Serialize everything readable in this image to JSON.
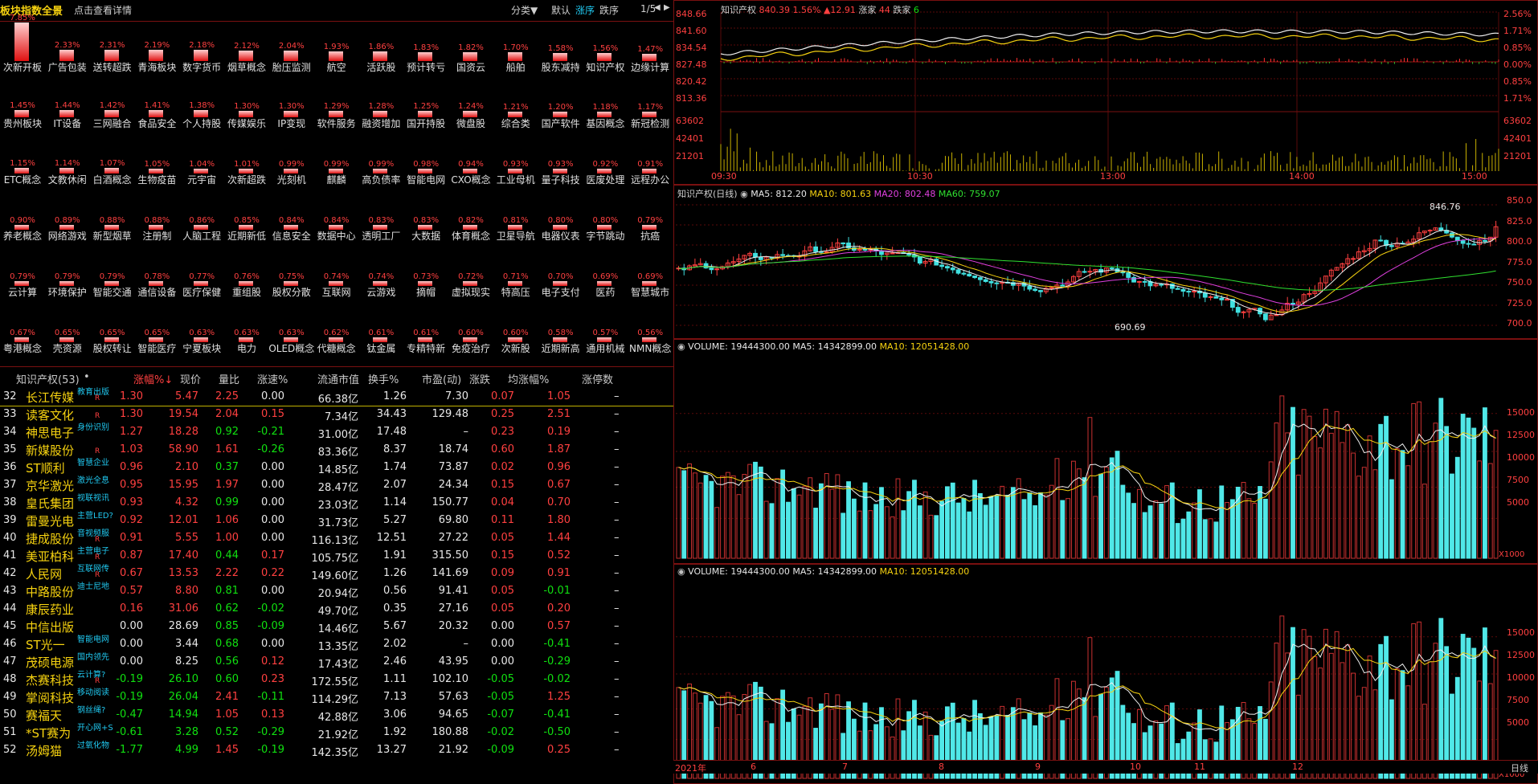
{
  "header": {
    "title": "板块指数全景",
    "detail_link": "点击查看详情",
    "sort_menu": "分类▼",
    "sort_default": "默认",
    "sort_up": "涨序",
    "sort_down": "跌序",
    "page": "1/5",
    "nav_left": "◀",
    "nav_right": "▶"
  },
  "sectors": [
    {
      "name": "次新开板",
      "pct": "7.85%",
      "v": 7.85
    },
    {
      "name": "广告包装",
      "pct": "2.33%",
      "v": 2.33
    },
    {
      "name": "送转超跌",
      "pct": "2.31%",
      "v": 2.31
    },
    {
      "name": "青海板块",
      "pct": "2.19%",
      "v": 2.19
    },
    {
      "name": "数字货币",
      "pct": "2.18%",
      "v": 2.18
    },
    {
      "name": "烟草概念",
      "pct": "2.12%",
      "v": 2.12
    },
    {
      "name": "胎压监测",
      "pct": "2.04%",
      "v": 2.04
    },
    {
      "name": "航空",
      "pct": "1.93%",
      "v": 1.93
    },
    {
      "name": "活跃股",
      "pct": "1.86%",
      "v": 1.86
    },
    {
      "name": "预计转亏",
      "pct": "1.83%",
      "v": 1.83
    },
    {
      "name": "国资云",
      "pct": "1.82%",
      "v": 1.82
    },
    {
      "name": "船舶",
      "pct": "1.70%",
      "v": 1.7
    },
    {
      "name": "股东减持",
      "pct": "1.58%",
      "v": 1.58
    },
    {
      "name": "知识产权",
      "pct": "1.56%",
      "v": 1.56
    },
    {
      "name": "边缘计算",
      "pct": "1.47%",
      "v": 1.47
    },
    {
      "name": "贵州板块",
      "pct": "1.45%",
      "v": 1.45
    },
    {
      "name": "IT设备",
      "pct": "1.44%",
      "v": 1.44
    },
    {
      "name": "三网融合",
      "pct": "1.42%",
      "v": 1.42
    },
    {
      "name": "食品安全",
      "pct": "1.41%",
      "v": 1.41
    },
    {
      "name": "个人持股",
      "pct": "1.38%",
      "v": 1.38
    },
    {
      "name": "传媒娱乐",
      "pct": "1.30%",
      "v": 1.3
    },
    {
      "name": "IP变现",
      "pct": "1.30%",
      "v": 1.3
    },
    {
      "name": "软件服务",
      "pct": "1.29%",
      "v": 1.29
    },
    {
      "name": "融资增加",
      "pct": "1.28%",
      "v": 1.28
    },
    {
      "name": "国开持股",
      "pct": "1.25%",
      "v": 1.25
    },
    {
      "name": "微盘股",
      "pct": "1.24%",
      "v": 1.24
    },
    {
      "name": "综合类",
      "pct": "1.21%",
      "v": 1.21
    },
    {
      "name": "国产软件",
      "pct": "1.20%",
      "v": 1.2
    },
    {
      "name": "基因概念",
      "pct": "1.18%",
      "v": 1.18
    },
    {
      "name": "新冠检测",
      "pct": "1.17%",
      "v": 1.17
    },
    {
      "name": "ETC概念",
      "pct": "1.15%",
      "v": 1.15
    },
    {
      "name": "文教休闲",
      "pct": "1.14%",
      "v": 1.14
    },
    {
      "name": "白酒概念",
      "pct": "1.07%",
      "v": 1.07
    },
    {
      "name": "生物疫苗",
      "pct": "1.05%",
      "v": 1.05
    },
    {
      "name": "元宇宙",
      "pct": "1.04%",
      "v": 1.04
    },
    {
      "name": "次新超跌",
      "pct": "1.01%",
      "v": 1.01
    },
    {
      "name": "光刻机",
      "pct": "0.99%",
      "v": 0.99
    },
    {
      "name": "麒麟",
      "pct": "0.99%",
      "v": 0.99
    },
    {
      "name": "高负债率",
      "pct": "0.99%",
      "v": 0.99
    },
    {
      "name": "智能电网",
      "pct": "0.98%",
      "v": 0.98
    },
    {
      "name": "CXO概念",
      "pct": "0.94%",
      "v": 0.94
    },
    {
      "name": "工业母机",
      "pct": "0.93%",
      "v": 0.93
    },
    {
      "name": "量子科技",
      "pct": "0.93%",
      "v": 0.93
    },
    {
      "name": "医废处理",
      "pct": "0.92%",
      "v": 0.92
    },
    {
      "name": "远程办公",
      "pct": "0.91%",
      "v": 0.91
    },
    {
      "name": "养老概念",
      "pct": "0.90%",
      "v": 0.9
    },
    {
      "name": "网络游戏",
      "pct": "0.89%",
      "v": 0.89
    },
    {
      "name": "新型烟草",
      "pct": "0.88%",
      "v": 0.88
    },
    {
      "name": "注册制",
      "pct": "0.88%",
      "v": 0.88
    },
    {
      "name": "人脑工程",
      "pct": "0.86%",
      "v": 0.86
    },
    {
      "name": "近期新低",
      "pct": "0.85%",
      "v": 0.85
    },
    {
      "name": "信息安全",
      "pct": "0.84%",
      "v": 0.84
    },
    {
      "name": "数据中心",
      "pct": "0.84%",
      "v": 0.84
    },
    {
      "name": "透明工厂",
      "pct": "0.83%",
      "v": 0.83
    },
    {
      "name": "大数据",
      "pct": "0.83%",
      "v": 0.83
    },
    {
      "name": "体育概念",
      "pct": "0.82%",
      "v": 0.82
    },
    {
      "name": "卫星导航",
      "pct": "0.81%",
      "v": 0.81
    },
    {
      "name": "电器仪表",
      "pct": "0.80%",
      "v": 0.8
    },
    {
      "name": "字节跳动",
      "pct": "0.80%",
      "v": 0.8
    },
    {
      "name": "抗癌",
      "pct": "0.79%",
      "v": 0.79
    },
    {
      "name": "云计算",
      "pct": "0.79%",
      "v": 0.79
    },
    {
      "name": "环境保护",
      "pct": "0.79%",
      "v": 0.79
    },
    {
      "name": "智能交通",
      "pct": "0.79%",
      "v": 0.79
    },
    {
      "name": "通信设备",
      "pct": "0.78%",
      "v": 0.78
    },
    {
      "name": "医疗保健",
      "pct": "0.77%",
      "v": 0.77
    },
    {
      "name": "重组股",
      "pct": "0.76%",
      "v": 0.76
    },
    {
      "name": "股权分散",
      "pct": "0.75%",
      "v": 0.75
    },
    {
      "name": "互联网",
      "pct": "0.74%",
      "v": 0.74
    },
    {
      "name": "云游戏",
      "pct": "0.74%",
      "v": 0.74
    },
    {
      "name": "摘帽",
      "pct": "0.73%",
      "v": 0.73
    },
    {
      "name": "虚拟现实",
      "pct": "0.72%",
      "v": 0.72
    },
    {
      "name": "特高压",
      "pct": "0.71%",
      "v": 0.71
    },
    {
      "name": "电子支付",
      "pct": "0.70%",
      "v": 0.7
    },
    {
      "name": "医药",
      "pct": "0.69%",
      "v": 0.69
    },
    {
      "name": "智慧城市",
      "pct": "0.69%",
      "v": 0.69
    },
    {
      "name": "粤港概念",
      "pct": "0.67%",
      "v": 0.67
    },
    {
      "name": "壳资源",
      "pct": "0.65%",
      "v": 0.65
    },
    {
      "name": "股权转让",
      "pct": "0.65%",
      "v": 0.65
    },
    {
      "name": "智能医疗",
      "pct": "0.65%",
      "v": 0.65
    },
    {
      "name": "宁夏板块",
      "pct": "0.63%",
      "v": 0.63
    },
    {
      "name": "电力",
      "pct": "0.63%",
      "v": 0.63
    },
    {
      "name": "OLED概念",
      "pct": "0.63%",
      "v": 0.63
    },
    {
      "name": "代糖概念",
      "pct": "0.62%",
      "v": 0.62
    },
    {
      "name": "钛金属",
      "pct": "0.61%",
      "v": 0.61
    },
    {
      "name": "专精特新",
      "pct": "0.61%",
      "v": 0.61
    },
    {
      "name": "免疫治疗",
      "pct": "0.60%",
      "v": 0.6
    },
    {
      "name": "次新股",
      "pct": "0.60%",
      "v": 0.6
    },
    {
      "name": "近期新高",
      "pct": "0.58%",
      "v": 0.58
    },
    {
      "name": "通用机械",
      "pct": "0.57%",
      "v": 0.57
    },
    {
      "name": "NMN概念",
      "pct": "0.56%",
      "v": 0.56
    }
  ],
  "table": {
    "headers": [
      "知识产权(53)",
      "•",
      "涨幅%↓",
      "现价",
      "量比",
      "涨速%",
      "流通市值",
      "换手%",
      "市盈(动)",
      "涨跌",
      "均涨幅%",
      "涨停数"
    ],
    "rows": [
      {
        "no": "32",
        "name": "长江传媒",
        "tag": "教育出版",
        "tagr": "R",
        "pct": "1.30",
        "price": "5.47",
        "vr": "2.25",
        "spd": "0.00",
        "cap": "66.38亿",
        "turn": "1.26",
        "pe": "7.30",
        "chg": "0.07",
        "avg": "1.05",
        "lim": "–",
        "c": [
          "red",
          "red",
          "red",
          "white",
          "red",
          "red"
        ]
      },
      {
        "no": "33",
        "name": "读客文化",
        "tag": "",
        "tagr": "R",
        "pct": "1.30",
        "price": "19.54",
        "vr": "2.04",
        "spd": "0.15",
        "cap": "7.34亿",
        "turn": "34.43",
        "pe": "129.48",
        "chg": "0.25",
        "avg": "2.51",
        "lim": "–",
        "c": [
          "red",
          "red",
          "red",
          "red",
          "red",
          "red"
        ]
      },
      {
        "no": "34",
        "name": "神思电子",
        "tag": "身份识别",
        "tagr": "",
        "pct": "1.27",
        "price": "18.28",
        "vr": "0.92",
        "spd": "-0.21",
        "cap": "31.00亿",
        "turn": "17.48",
        "pe": "–",
        "chg": "0.23",
        "avg": "0.19",
        "lim": "–",
        "c": [
          "red",
          "red",
          "green",
          "green",
          "red",
          "red"
        ]
      },
      {
        "no": "35",
        "name": "新媒股份",
        "tag": "",
        "tagr": "R",
        "pct": "1.03",
        "price": "58.90",
        "vr": "1.61",
        "spd": "-0.26",
        "cap": "83.36亿",
        "turn": "8.37",
        "pe": "18.74",
        "chg": "0.60",
        "avg": "1.87",
        "lim": "–",
        "c": [
          "red",
          "red",
          "red",
          "green",
          "red",
          "red"
        ]
      },
      {
        "no": "36",
        "name": "ST顺利",
        "tag": "智慧企业",
        "tagr": "",
        "pct": "0.96",
        "price": "2.10",
        "vr": "0.37",
        "spd": "0.00",
        "cap": "14.85亿",
        "turn": "1.74",
        "pe": "73.87",
        "chg": "0.02",
        "avg": "0.96",
        "lim": "–",
        "c": [
          "red",
          "red",
          "green",
          "white",
          "red",
          "red"
        ]
      },
      {
        "no": "37",
        "name": "京华激光",
        "tag": "激光全息",
        "tagr": "",
        "pct": "0.95",
        "price": "15.95",
        "vr": "1.97",
        "spd": "0.00",
        "cap": "28.47亿",
        "turn": "2.07",
        "pe": "24.34",
        "chg": "0.15",
        "avg": "0.67",
        "lim": "–",
        "c": [
          "red",
          "red",
          "red",
          "white",
          "red",
          "red"
        ]
      },
      {
        "no": "38",
        "name": "皇氏集团",
        "tag": "视联视讯",
        "tagr": "",
        "pct": "0.93",
        "price": "4.32",
        "vr": "0.99",
        "spd": "0.00",
        "cap": "23.03亿",
        "turn": "1.14",
        "pe": "150.77",
        "chg": "0.04",
        "avg": "0.70",
        "lim": "–",
        "c": [
          "red",
          "red",
          "green",
          "white",
          "red",
          "red"
        ]
      },
      {
        "no": "39",
        "name": "雷曼光电",
        "tag": "主营LED?",
        "tagr": "",
        "pct": "0.92",
        "price": "12.01",
        "vr": "1.06",
        "spd": "0.00",
        "cap": "31.73亿",
        "turn": "5.27",
        "pe": "69.80",
        "chg": "0.11",
        "avg": "1.80",
        "lim": "–",
        "c": [
          "red",
          "red",
          "red",
          "white",
          "red",
          "red"
        ]
      },
      {
        "no": "40",
        "name": "捷成股份",
        "tag": "音视频服",
        "tagr": "R",
        "pct": "0.91",
        "price": "5.55",
        "vr": "1.00",
        "spd": "0.00",
        "cap": "116.13亿",
        "turn": "12.51",
        "pe": "27.22",
        "chg": "0.05",
        "avg": "1.44",
        "lim": "–",
        "c": [
          "red",
          "red",
          "red",
          "white",
          "red",
          "red"
        ]
      },
      {
        "no": "41",
        "name": "美亚柏科",
        "tag": "主营电子",
        "tagr": "R",
        "pct": "0.87",
        "price": "17.40",
        "vr": "0.44",
        "spd": "0.17",
        "cap": "105.75亿",
        "turn": "1.91",
        "pe": "315.50",
        "chg": "0.15",
        "avg": "0.52",
        "lim": "–",
        "c": [
          "red",
          "red",
          "green",
          "red",
          "red",
          "red"
        ]
      },
      {
        "no": "42",
        "name": "人民网",
        "tag": "互联网传",
        "tagr": "R",
        "pct": "0.67",
        "price": "13.53",
        "vr": "2.22",
        "spd": "0.22",
        "cap": "149.60亿",
        "turn": "1.26",
        "pe": "141.69",
        "chg": "0.09",
        "avg": "0.91",
        "lim": "–",
        "c": [
          "red",
          "red",
          "red",
          "red",
          "red",
          "red"
        ]
      },
      {
        "no": "43",
        "name": "中路股份",
        "tag": "迪士尼地",
        "tagr": "",
        "pct": "0.57",
        "price": "8.80",
        "vr": "0.81",
        "spd": "0.00",
        "cap": "20.94亿",
        "turn": "0.56",
        "pe": "91.41",
        "chg": "0.05",
        "avg": "-0.01",
        "lim": "–",
        "c": [
          "red",
          "red",
          "green",
          "white",
          "red",
          "green"
        ]
      },
      {
        "no": "44",
        "name": "康辰药业",
        "tag": "",
        "tagr": "",
        "pct": "0.16",
        "price": "31.06",
        "vr": "0.62",
        "spd": "-0.02",
        "cap": "49.70亿",
        "turn": "0.35",
        "pe": "27.16",
        "chg": "0.05",
        "avg": "0.20",
        "lim": "–",
        "c": [
          "red",
          "red",
          "green",
          "green",
          "red",
          "red"
        ]
      },
      {
        "no": "45",
        "name": "中信出版",
        "tag": "",
        "tagr": "",
        "pct": "0.00",
        "price": "28.69",
        "vr": "0.85",
        "spd": "-0.09",
        "cap": "14.46亿",
        "turn": "5.67",
        "pe": "20.32",
        "chg": "0.00",
        "avg": "0.57",
        "lim": "–",
        "c": [
          "white",
          "white",
          "green",
          "green",
          "white",
          "red"
        ]
      },
      {
        "no": "46",
        "name": "ST光一",
        "tag": "智能电网",
        "tagr": "",
        "pct": "0.00",
        "price": "3.44",
        "vr": "0.68",
        "spd": "0.00",
        "cap": "13.35亿",
        "turn": "2.02",
        "pe": "–",
        "chg": "0.00",
        "avg": "-0.41",
        "lim": "–",
        "c": [
          "white",
          "white",
          "green",
          "white",
          "white",
          "green"
        ]
      },
      {
        "no": "47",
        "name": "茂硕电源",
        "tag": "国内领先",
        "tagr": "",
        "pct": "0.00",
        "price": "8.25",
        "vr": "0.56",
        "spd": "0.12",
        "cap": "17.43亿",
        "turn": "2.46",
        "pe": "43.95",
        "chg": "0.00",
        "avg": "-0.29",
        "lim": "–",
        "c": [
          "white",
          "white",
          "green",
          "red",
          "white",
          "green"
        ]
      },
      {
        "no": "48",
        "name": "杰赛科技",
        "tag": "云计算?",
        "tagr": "R",
        "pct": "-0.19",
        "price": "26.10",
        "vr": "0.60",
        "spd": "0.23",
        "cap": "172.55亿",
        "turn": "1.11",
        "pe": "102.10",
        "chg": "-0.05",
        "avg": "-0.02",
        "lim": "–",
        "c": [
          "green",
          "green",
          "green",
          "red",
          "green",
          "green"
        ]
      },
      {
        "no": "49",
        "name": "掌阅科技",
        "tag": "移动阅读",
        "tagr": "",
        "pct": "-0.19",
        "price": "26.04",
        "vr": "2.41",
        "spd": "-0.11",
        "cap": "114.29亿",
        "turn": "7.13",
        "pe": "57.63",
        "chg": "-0.05",
        "avg": "1.25",
        "lim": "–",
        "c": [
          "green",
          "green",
          "red",
          "green",
          "green",
          "red"
        ]
      },
      {
        "no": "50",
        "name": "赛福天",
        "tag": "钢丝绳?",
        "tagr": "",
        "pct": "-0.47",
        "price": "14.94",
        "vr": "1.05",
        "spd": "0.13",
        "cap": "42.88亿",
        "turn": "3.06",
        "pe": "94.65",
        "chg": "-0.07",
        "avg": "-0.41",
        "lim": "–",
        "c": [
          "green",
          "green",
          "red",
          "red",
          "green",
          "green"
        ]
      },
      {
        "no": "51",
        "name": "*ST赛为",
        "tag": "开心网+S",
        "tagr": "",
        "pct": "-0.61",
        "price": "3.28",
        "vr": "0.52",
        "spd": "-0.29",
        "cap": "21.92亿",
        "turn": "1.92",
        "pe": "180.88",
        "chg": "-0.02",
        "avg": "-0.50",
        "lim": "–",
        "c": [
          "green",
          "green",
          "green",
          "green",
          "green",
          "green"
        ]
      },
      {
        "no": "52",
        "name": "汤姆猫",
        "tag": "过氧化物",
        "tagr": "",
        "pct": "-1.77",
        "price": "4.99",
        "vr": "1.45",
        "spd": "-0.19",
        "cap": "142.35亿",
        "turn": "13.27",
        "pe": "21.92",
        "chg": "-0.09",
        "avg": "0.25",
        "lim": "–",
        "c": [
          "green",
          "green",
          "red",
          "green",
          "green",
          "red"
        ]
      }
    ]
  },
  "intraday": {
    "title": "知识产权",
    "price": "840.39",
    "pct": "1.56%",
    "chg": "▲12.91",
    "up_label": "涨家",
    "up": "44",
    "down_label": "跌家",
    "down": "6",
    "left_axis": [
      "848.66",
      "841.60",
      "834.54",
      "827.48",
      "820.42",
      "813.36"
    ],
    "right_axis": [
      "2.56%",
      "1.71%",
      "0.85%",
      "0.00%",
      "0.85%",
      "1.71%"
    ],
    "vol_axis": [
      "63602",
      "42401",
      "21201"
    ],
    "time_labels": [
      "09:30",
      "10:30",
      "13:00",
      "14:00",
      "15:00"
    ]
  },
  "daily": {
    "title": "知识产权(日线)",
    "ma5": "MA5: 812.20",
    "ma10": "MA10: 801.63",
    "ma20": "MA20: 802.48",
    "ma60": "MA60: 759.07",
    "high_label": "846.76",
    "low_label": "690.69",
    "axis": [
      "850.0",
      "825.0",
      "800.0",
      "775.0",
      "750.0",
      "725.0",
      "700.0"
    ]
  },
  "volume1": {
    "title": "VOLUME: 19444300.00",
    "ma5": "MA5: 14342899.00",
    "ma10": "MA10: 12051428.00",
    "axis": [
      "15000",
      "12500",
      "10000",
      "7500",
      "5000"
    ],
    "unit": "X1000"
  },
  "volume2": {
    "title": "VOLUME: 19444300.00",
    "ma5": "MA5: 14342899.00",
    "ma10": "MA10: 12051428.00",
    "axis": [
      "15000",
      "12500",
      "10000",
      "7500",
      "5000"
    ],
    "unit": "X1000"
  },
  "xaxis": {
    "labels": [
      "2021年",
      "6",
      "7",
      "8",
      "9",
      "10",
      "11",
      "12"
    ],
    "period": "日线"
  },
  "colors": {
    "up": "#ff4040",
    "down": "#40e0e0",
    "accent": "#f6d210",
    "grid": "#7a1010"
  }
}
